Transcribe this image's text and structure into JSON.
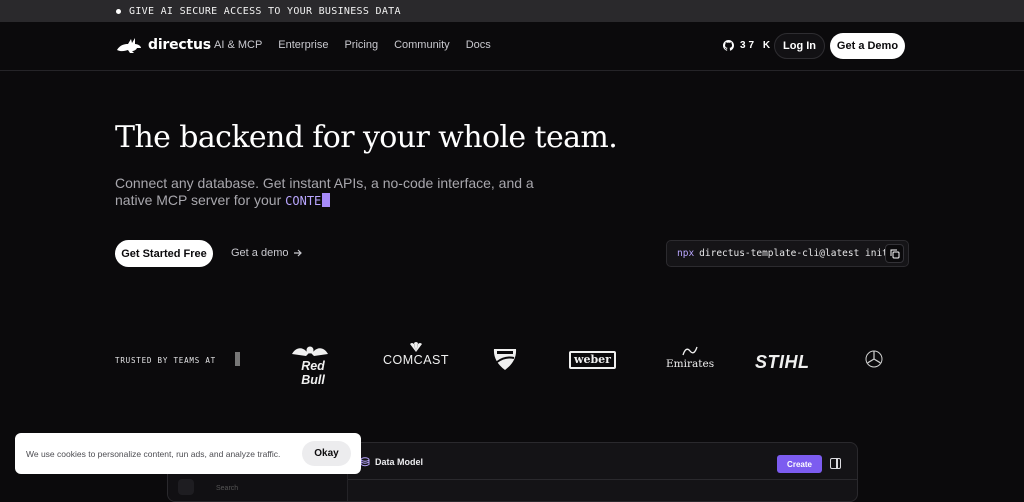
{
  "announcement": {
    "text": "GIVE AI SECURE ACCESS TO YOUR BUSINESS DATA"
  },
  "nav": {
    "logo_text": "directus",
    "links": [
      "AI & MCP",
      "Enterprise",
      "Pricing",
      "Community",
      "Docs"
    ],
    "github_stars": "37 K",
    "login_label": "Log In",
    "demo_label": "Get a Demo"
  },
  "hero": {
    "title": "The backend for your whole team.",
    "subtitle": "Connect any database. Get instant APIs, a no-code interface, and a native MCP server for your",
    "typed_word": "CONTE",
    "cta_primary": "Get Started Free",
    "cta_secondary": "Get a demo",
    "cli_prefix": "npx",
    "cli_command": "directus-template-cli@latest init"
  },
  "trusted": {
    "label": "TRUSTED BY TEAMS AT",
    "logos": [
      "Red Bull",
      "COMCAST",
      "DUCATI",
      "weber",
      "Emirates",
      "STIHL",
      "Mercedes-Benz"
    ]
  },
  "app_preview": {
    "section_title": "Data Model",
    "create_label": "Create",
    "search_placeholder": "Search"
  },
  "cookie": {
    "text": "We use cookies to personalize content, run ads, and analyze traffic.",
    "okay_label": "Okay"
  },
  "colors": {
    "accent": "#7c5cf0",
    "typed": "#b9a6ff",
    "background": "#0b0a0c"
  },
  "icons": [
    "rabbit-logo-icon",
    "github-icon",
    "arrow-right-icon",
    "copy-icon",
    "database-icon",
    "panel-toggle-icon"
  ]
}
